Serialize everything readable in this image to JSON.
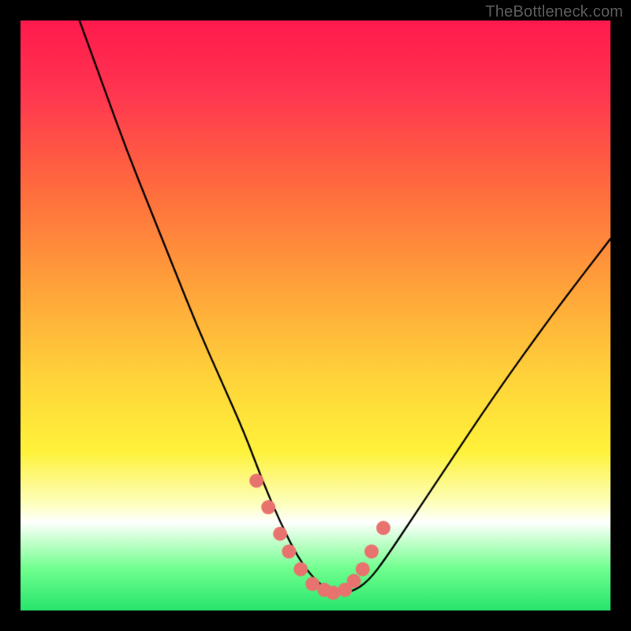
{
  "watermark": {
    "text": "TheBottleneck.com"
  },
  "colors": {
    "frame": "#000000",
    "gradient_stops": [
      {
        "t": 0.0,
        "c": "#ff1a4d"
      },
      {
        "t": 0.12,
        "c": "#ff3550"
      },
      {
        "t": 0.28,
        "c": "#ff6a3e"
      },
      {
        "t": 0.45,
        "c": "#ffa23a"
      },
      {
        "t": 0.6,
        "c": "#ffd23a"
      },
      {
        "t": 0.73,
        "c": "#fff23a"
      },
      {
        "t": 0.82,
        "c": "#fdffbf"
      },
      {
        "t": 0.85,
        "c": "#ffffff"
      },
      {
        "t": 0.88,
        "c": "#c9ffd0"
      },
      {
        "t": 0.93,
        "c": "#6fff8e"
      },
      {
        "t": 1.0,
        "c": "#27e56b"
      }
    ],
    "curve": "#000000",
    "marker_fill": "#e8736e",
    "marker_stroke": "#c9524d"
  },
  "chart_data": {
    "type": "line",
    "title": "",
    "xlabel": "",
    "ylabel": "",
    "xlim": [
      0,
      100
    ],
    "ylim": [
      0,
      100
    ],
    "series": [
      {
        "name": "bottleneck-curve",
        "x": [
          10,
          14,
          18,
          22,
          26,
          30,
          34,
          38,
          41,
          44,
          47,
          50,
          53,
          56,
          59,
          62,
          66,
          72,
          80,
          90,
          100
        ],
        "y": [
          100,
          89,
          78,
          68,
          58,
          48,
          39,
          30,
          22,
          15,
          9,
          5,
          3,
          3,
          5,
          9,
          15,
          24,
          36,
          50,
          63
        ]
      }
    ],
    "markers": {
      "name": "highlight-dots",
      "x": [
        40,
        42,
        44,
        45.5,
        47.5,
        49.5,
        51.5,
        53.0,
        55.0,
        56.5,
        58.0,
        59.5,
        61.5
      ],
      "y": [
        22,
        17.5,
        13,
        10,
        7,
        4.5,
        3.5,
        3.0,
        3.5,
        5.0,
        7.0,
        10.0,
        14.0
      ],
      "radius": 9
    }
  }
}
